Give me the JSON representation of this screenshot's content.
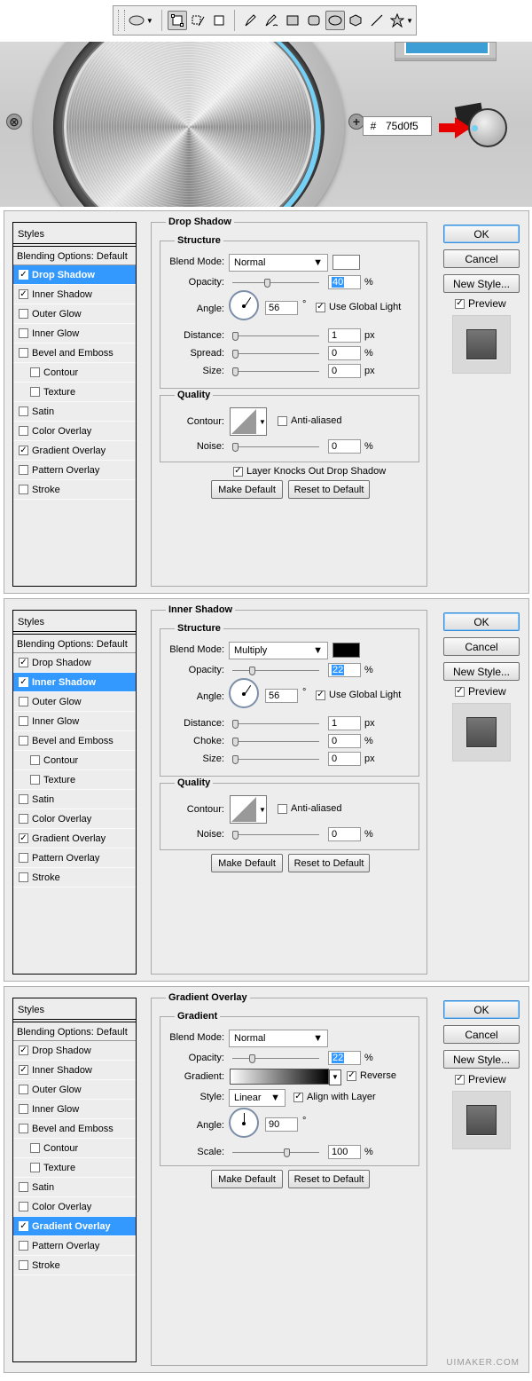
{
  "toolbar": {
    "tools": [
      "ellipse-tool-preset",
      "shape-layers",
      "paths",
      "fill-pixels",
      "pen",
      "freeform-pen",
      "rectangle",
      "rounded-rectangle",
      "ellipse",
      "polygon",
      "line",
      "custom-shape"
    ]
  },
  "scene": {
    "hex_prefix": "#",
    "hex_value": "75d0f5",
    "accent_color": "#75d0f5"
  },
  "list_labels": {
    "styles": "Styles",
    "blending": "Blending Options: Default",
    "drop_shadow": "Drop Shadow",
    "inner_shadow": "Inner Shadow",
    "outer_glow": "Outer Glow",
    "inner_glow": "Inner Glow",
    "bevel": "Bevel and Emboss",
    "contour": "Contour",
    "texture": "Texture",
    "satin": "Satin",
    "color_overlay": "Color Overlay",
    "gradient_overlay": "Gradient Overlay",
    "pattern_overlay": "Pattern Overlay",
    "stroke": "Stroke"
  },
  "side": {
    "ok": "OK",
    "cancel": "Cancel",
    "new_style": "New Style...",
    "preview": "Preview"
  },
  "common": {
    "make_default": "Make Default",
    "reset_default": "Reset to Default",
    "structure": "Structure",
    "quality": "Quality",
    "blend_mode": "Blend Mode:",
    "opacity": "Opacity:",
    "angle": "Angle:",
    "use_global_light": "Use Global Light",
    "distance": "Distance:",
    "size": "Size:",
    "contour": "Contour:",
    "anti_aliased": "Anti-aliased",
    "noise": "Noise:",
    "pct": "%",
    "px": "px",
    "deg": "°"
  },
  "drop_shadow": {
    "title": "Drop Shadow",
    "blend_mode": "Normal",
    "color": "#ffffff",
    "opacity": "40",
    "angle": "56",
    "distance": "1",
    "spread_label": "Spread:",
    "spread": "0",
    "size": "0",
    "noise": "0",
    "knocks_out": "Layer Knocks Out Drop Shadow"
  },
  "inner_shadow": {
    "title": "Inner Shadow",
    "blend_mode": "Multiply",
    "color": "#000000",
    "opacity": "22",
    "angle": "56",
    "distance": "1",
    "choke_label": "Choke:",
    "choke": "0",
    "size": "0",
    "noise": "0"
  },
  "gradient_overlay": {
    "title": "Gradient Overlay",
    "group": "Gradient",
    "blend_mode": "Normal",
    "opacity": "22",
    "gradient_label": "Gradient:",
    "reverse": "Reverse",
    "style_label": "Style:",
    "style": "Linear",
    "align": "Align with Layer",
    "angle": "90",
    "scale_label": "Scale:",
    "scale": "100"
  },
  "watermark": "UIMAKER.COM"
}
